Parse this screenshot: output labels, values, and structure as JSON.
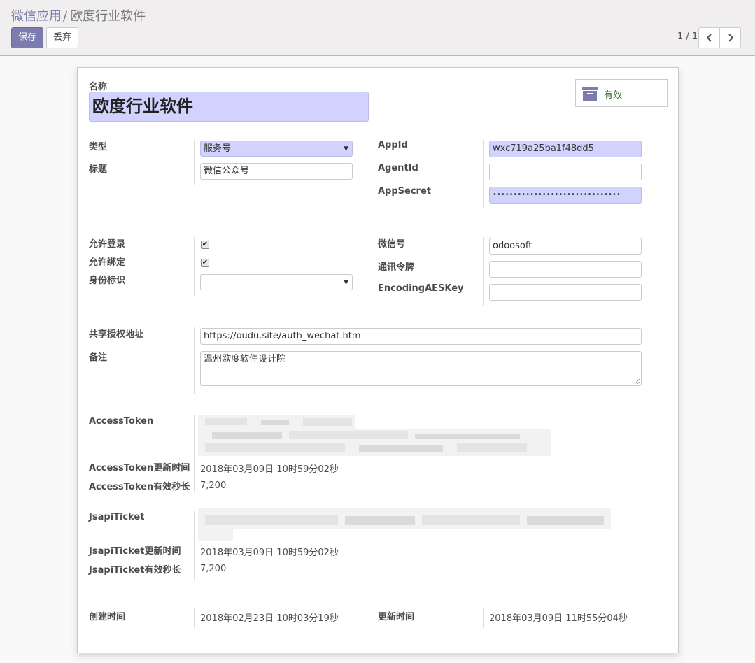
{
  "breadcrumb": {
    "parent": "微信应用",
    "separator": "/",
    "current": "欧度行业软件"
  },
  "toolbar": {
    "save_label": "保存",
    "discard_label": "丢弃"
  },
  "pager": {
    "value": "1 / 1"
  },
  "status_button": {
    "label": "有效",
    "icon": "archive-icon"
  },
  "form": {
    "name_label": "名称",
    "name_value": "欧度行业软件",
    "type_label": "类型",
    "type_value": "服务号",
    "title_label": "标题",
    "title_value": "微信公众号",
    "appid_label": "AppId",
    "appid_value": "wxc719a25ba1f48dd5",
    "agentid_label": "AgentId",
    "agentid_value": "",
    "appsecret_label": "AppSecret",
    "appsecret_value": "•••••••••••••••••••••••••••••••",
    "allow_login_label": "允许登录",
    "allow_login_checked": true,
    "allow_bind_label": "允许绑定",
    "allow_bind_checked": true,
    "identity_label": "身份标识",
    "identity_value": "",
    "wechat_id_label": "微信号",
    "wechat_id_value": "odoosoft",
    "token_label": "通讯令牌",
    "token_value": "",
    "aeskey_label": "EncodingAESKey",
    "aeskey_value": "",
    "share_url_label": "共享授权地址",
    "share_url_value": "https://oudu.site/auth_wechat.htm",
    "note_label": "备注",
    "note_value": "温州欧度软件设计院",
    "access_token_label": "AccessToken",
    "access_token_updated_label": "AccessToken更新时间",
    "access_token_updated_value": "2018年03月09日 10时59分02秒",
    "access_token_expires_label": "AccessToken有效秒长",
    "access_token_expires_value": "7,200",
    "jsapi_ticket_label": "JsapiTicket",
    "jsapi_ticket_updated_label": "JsapiTicket更新时间",
    "jsapi_ticket_updated_value": "2018年03月09日 10时59分02秒",
    "jsapi_ticket_expires_label": "JsapiTicket有效秒长",
    "jsapi_ticket_expires_value": "7,200",
    "created_label": "创建时间",
    "created_value": "2018年02月23日 10时03分19秒",
    "modified_label": "更新时间",
    "modified_value": "2018年03月09日 11时55分04秒"
  },
  "colors": {
    "primary": "#7c7bad",
    "required_bg": "#d2d2ff",
    "status_text": "#2d6a2d"
  }
}
